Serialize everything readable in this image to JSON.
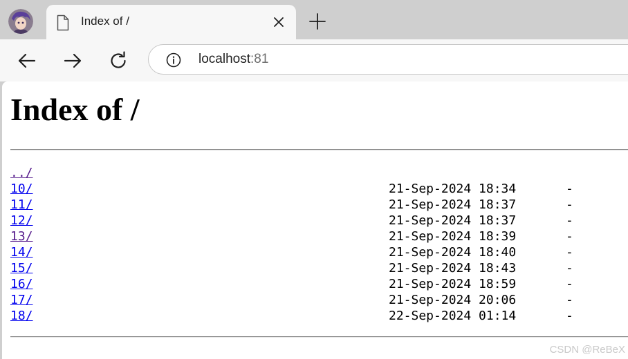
{
  "tab": {
    "title": "Index of /",
    "favicon": "page-icon",
    "close_icon": "close-icon"
  },
  "toolbar": {
    "back_icon": "arrow-left-icon",
    "forward_icon": "arrow-right-icon",
    "reload_icon": "reload-icon",
    "site_info_icon": "info-icon",
    "url_host": "localhost",
    "url_port": ":81"
  },
  "page": {
    "heading": "Index of /",
    "parent_link": "../",
    "entries": [
      {
        "name": "10/",
        "date": "21-Sep-2024 18:34",
        "size": "-"
      },
      {
        "name": "11/",
        "date": "21-Sep-2024 18:37",
        "size": "-"
      },
      {
        "name": "12/",
        "date": "21-Sep-2024 18:37",
        "size": "-"
      },
      {
        "name": "13/",
        "date": "21-Sep-2024 18:39",
        "size": "-"
      },
      {
        "name": "14/",
        "date": "21-Sep-2024 18:40",
        "size": "-"
      },
      {
        "name": "15/",
        "date": "21-Sep-2024 18:43",
        "size": "-"
      },
      {
        "name": "16/",
        "date": "21-Sep-2024 18:59",
        "size": "-"
      },
      {
        "name": "17/",
        "date": "21-Sep-2024 20:06",
        "size": "-"
      },
      {
        "name": "18/",
        "date": "22-Sep-2024 01:14",
        "size": "-"
      }
    ]
  },
  "watermark": "CSDN @ReBeX",
  "colors": {
    "link": "#0000ee",
    "visited_link": "#551a8b",
    "tabstrip": "#cfcfcf",
    "toolbar": "#f7f7f7"
  }
}
